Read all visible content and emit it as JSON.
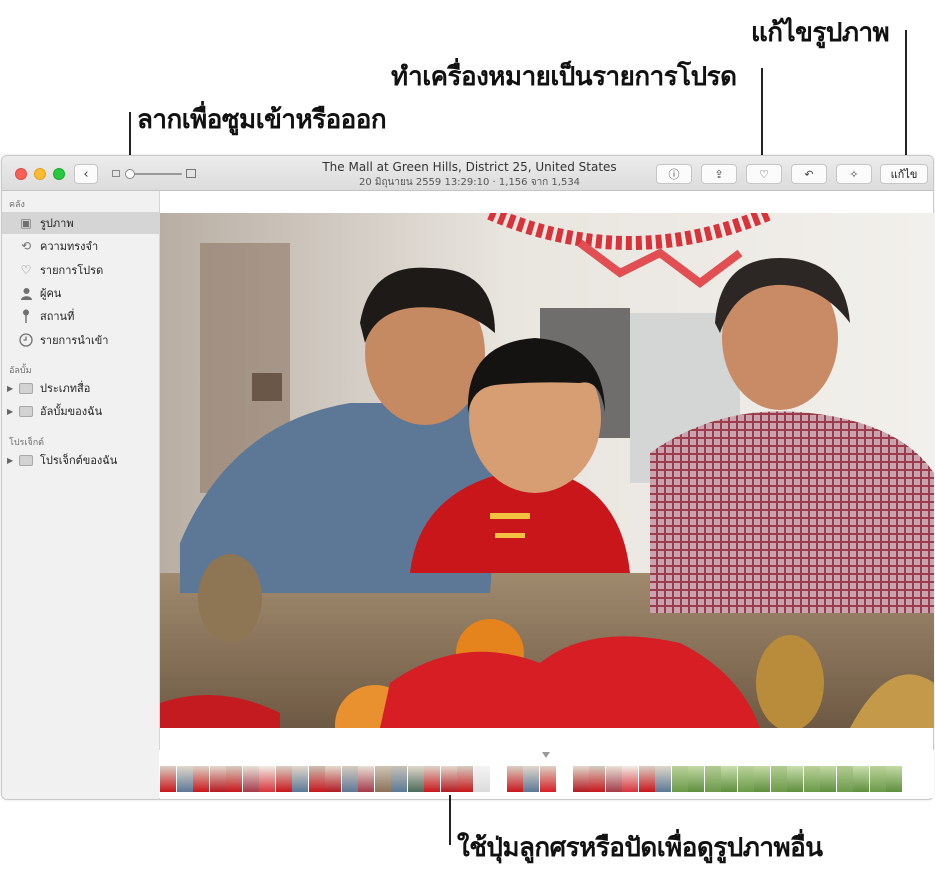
{
  "callouts": {
    "edit_photo": "แก้ไขรูปภาพ",
    "mark_favorite": "ทำเครื่องหมายเป็นรายการโปรด",
    "zoom": "ลากเพื่อซูมเข้าหรือออก",
    "browse": "ใช้ปุ่มลูกศรหรือปัดเพื่อดูรูปภาพอื่น"
  },
  "window": {
    "title": "The Mall at Green Hills, District 25, United States",
    "subtitle": "20 มิถุนายน 2559 13:29:10  ·  1,156 จาก 1,534",
    "toolbar": {
      "back_glyph": "‹",
      "edit_label": "แก้ไข",
      "info_glyph": "ⓘ",
      "share_glyph": "⇪",
      "favorite_glyph": "♡",
      "rotate_glyph": "↶",
      "enhance_glyph": "✧"
    },
    "zoom_level": 0.0
  },
  "sidebar": {
    "library_heading": "คลัง",
    "library_items": [
      {
        "label": "รูปภาพ",
        "icon": "photos-icon",
        "glyph": "▣"
      },
      {
        "label": "ความทรงจำ",
        "icon": "memories-icon",
        "glyph": "⟲"
      },
      {
        "label": "รายการโปรด",
        "icon": "heart-icon",
        "glyph": "♡"
      },
      {
        "label": "ผู้คน",
        "icon": "person-icon",
        "glyph": "👤"
      },
      {
        "label": "สถานที่",
        "icon": "pin-icon",
        "glyph": "📍"
      },
      {
        "label": "รายการนำเข้า",
        "icon": "clock-icon",
        "glyph": "🕘"
      }
    ],
    "albums_heading": "อัลบั้ม",
    "album_items": [
      {
        "label": "ประเภทสื่อ",
        "disclosure": "▶"
      },
      {
        "label": "อัลบั้มของฉัน",
        "disclosure": "▶"
      }
    ],
    "projects_heading": "โปรเจ็กต์",
    "project_items": [
      {
        "label": "โปรเจ็กต์ของฉัน",
        "disclosure": "▶"
      }
    ]
  },
  "colors": {
    "wall": "#e7e2db",
    "shirt_blue": "#5d7896",
    "shirt_red": "#c8161b",
    "plaid": "#9b3b4c",
    "table": "#8a7258",
    "orange": "#e5831d"
  }
}
